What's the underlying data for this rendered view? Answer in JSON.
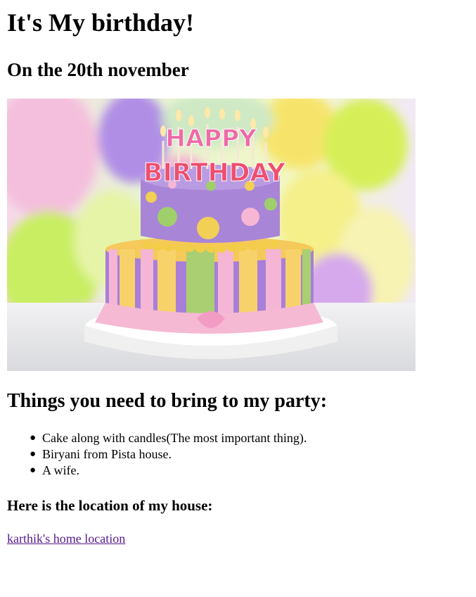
{
  "page": {
    "title": "It's My birthday!",
    "date_line": "On the 20th november"
  },
  "hero_image": {
    "alt": "Birthday cake with candles",
    "top_text": "HAPPY",
    "bottom_text": "BIRTHDAY"
  },
  "bring": {
    "heading": "Things you need to bring to my party:",
    "items": [
      "Cake along with candles(The most important thing).",
      "Biryani from Pista house.",
      "A wife."
    ]
  },
  "location": {
    "heading": "Here is the location of my house:",
    "link_text": "karthik's home location"
  },
  "colors": {
    "link": "#551a8b",
    "text": "#000000"
  }
}
